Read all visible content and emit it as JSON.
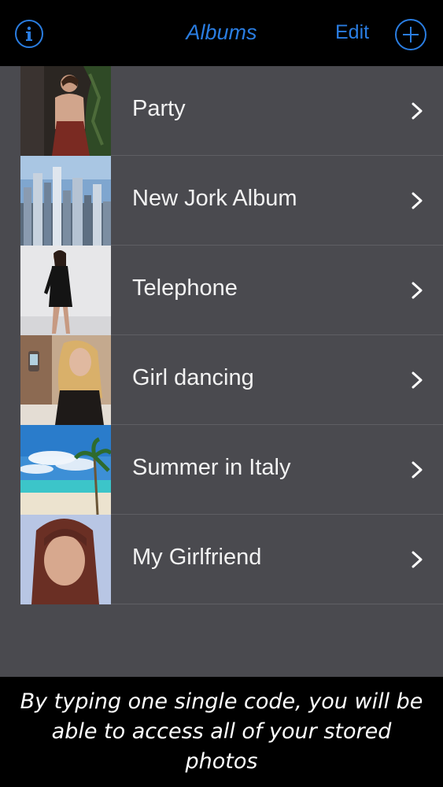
{
  "navbar": {
    "title": "Albums",
    "edit_label": "Edit",
    "info_icon": "info-icon",
    "add_icon": "plus-icon"
  },
  "albums": [
    {
      "name": "Party",
      "thumb": "photo-woman-dark-dress"
    },
    {
      "name": "New Jork Album",
      "thumb": "photo-city-skyline"
    },
    {
      "name": "Telephone",
      "thumb": "photo-woman-black-dress"
    },
    {
      "name": "Girl dancing",
      "thumb": "photo-woman-blonde"
    },
    {
      "name": "Summer in Italy",
      "thumb": "photo-beach-palms"
    },
    {
      "name": "My Girlfriend",
      "thumb": "photo-woman-portrait"
    }
  ],
  "caption": {
    "text": "By typing one single code, you will be able to access all of your stored photos"
  },
  "colors": {
    "accent": "#2a7de1",
    "list_background": "#4a4a4f",
    "bar_background": "#000000"
  }
}
